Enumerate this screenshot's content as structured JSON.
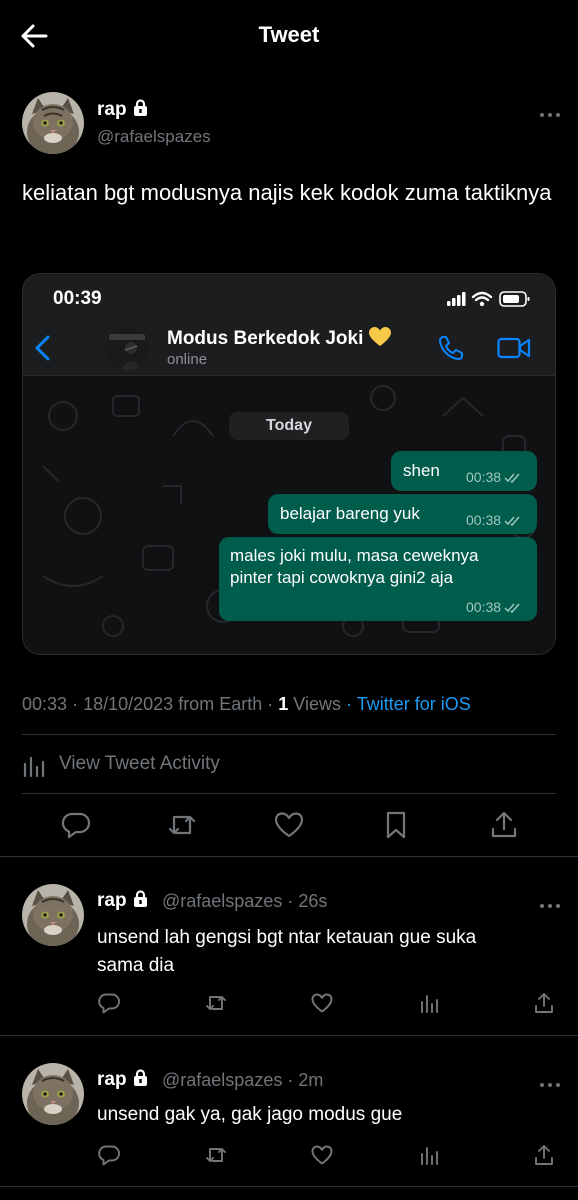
{
  "header": {
    "title": "Tweet"
  },
  "tweet": {
    "author_name": "rap",
    "handle": "@rafaelspazes",
    "text": "keliatan bgt modusnya najis kek kodok zuma taktiknya",
    "time": "00:33",
    "date": "18/10/2023",
    "origin": "from Earth",
    "views_count": "1",
    "views_label": "Views",
    "client": "Twitter for iOS",
    "activity_label": "View Tweet Activity"
  },
  "screenshot": {
    "status_time": "00:39",
    "contact_name": "Modus Berkedok Joki",
    "contact_emoji": "yellow-heart-icon",
    "contact_status": "online",
    "date_chip": "Today",
    "messages": [
      {
        "text": "shen",
        "time": "00:38"
      },
      {
        "text": "belajar bareng yuk",
        "time": "00:38"
      },
      {
        "line1": "males joki mulu, masa ceweknya",
        "line2": "pinter tapi cowoknya gini2 aja",
        "time": "00:38"
      }
    ]
  },
  "replies": [
    {
      "author_name": "rap",
      "handle_time": "@rafaelspazes · 26s",
      "line1": "unsend lah gengsi bgt ntar ketauan gue suka",
      "line2": "sama dia"
    },
    {
      "author_name": "rap",
      "handle_time": "@rafaelspazes · 2m",
      "line1": "unsend gak ya, gak jago modus gue"
    }
  ],
  "colors": {
    "background": "#000000",
    "text": "#e7e9ea",
    "muted": "#71767b",
    "link": "#1d9bf0",
    "divider": "#2f3336",
    "whatsapp_bubble": "#005c4b",
    "whatsapp_accent": "#0a84ff"
  }
}
